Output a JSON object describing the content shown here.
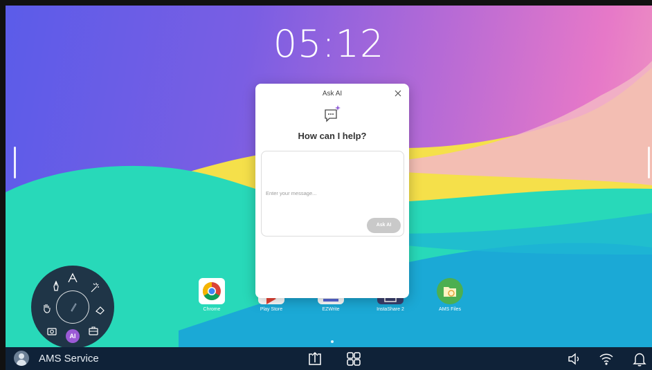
{
  "clock": {
    "time": "05:12"
  },
  "dialog": {
    "title": "Ask AI",
    "heading": "How can I help?",
    "input_placeholder": "Enter your message...",
    "send_label": "Ask AI"
  },
  "apps": [
    {
      "label": "Chrome",
      "icon": "chrome-icon"
    },
    {
      "label": "Play Store",
      "icon": "play-store-icon"
    },
    {
      "label": "EZWrite",
      "icon": "ezwrite-icon"
    },
    {
      "label": "InstaShare 2",
      "icon": "instashare-icon"
    },
    {
      "label": "AMS Files",
      "icon": "ams-files-icon"
    }
  ],
  "taskbar": {
    "user_name": "AMS Service",
    "icons": [
      "screen-share-icon",
      "apps-grid-icon",
      "volume-icon",
      "wifi-icon",
      "notification-bell-icon"
    ]
  },
  "pen_wheel": {
    "ai_label": "AI",
    "icons": [
      "pen-icon",
      "text-icon",
      "magic-wand-icon",
      "hand-icon",
      "center-pen-icon",
      "eraser-icon",
      "camera-icon",
      "toolbox-icon"
    ]
  },
  "colors": {
    "taskbar": "#0f2238",
    "wheel": "#1f3547",
    "ai_accent": "#9b5ad6",
    "send_button": "#c9c9c9"
  }
}
